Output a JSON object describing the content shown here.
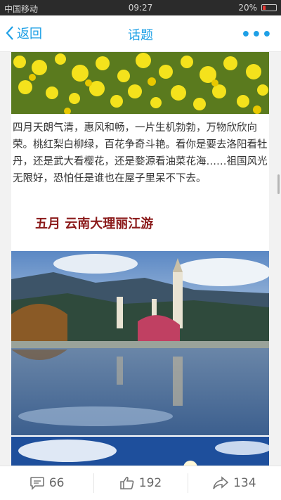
{
  "statusbar": {
    "carrier": "中国移动",
    "time": "09:27",
    "battery": "20%",
    "battery_level": 0.2
  },
  "navbar": {
    "back_label": "返回",
    "title": "话题",
    "more_label": "•••"
  },
  "article": {
    "paragraph": "四月天朗气清，惠风和畅，一片生机勃勃，万物欣欣向荣。桃红梨白柳绿，百花争奇斗艳。看你是要去洛阳看牡丹，还是武大看樱花，还是婺源看油菜花海……祖国风光无限好，恐怕任是谁也在屋子里呆不下去。",
    "heading": "五月 云南大理丽江游"
  },
  "actions": {
    "comments": "66",
    "likes": "192",
    "shares": "134"
  },
  "colors": {
    "accent": "#1ea0e6",
    "heading": "#8b1a1a"
  }
}
